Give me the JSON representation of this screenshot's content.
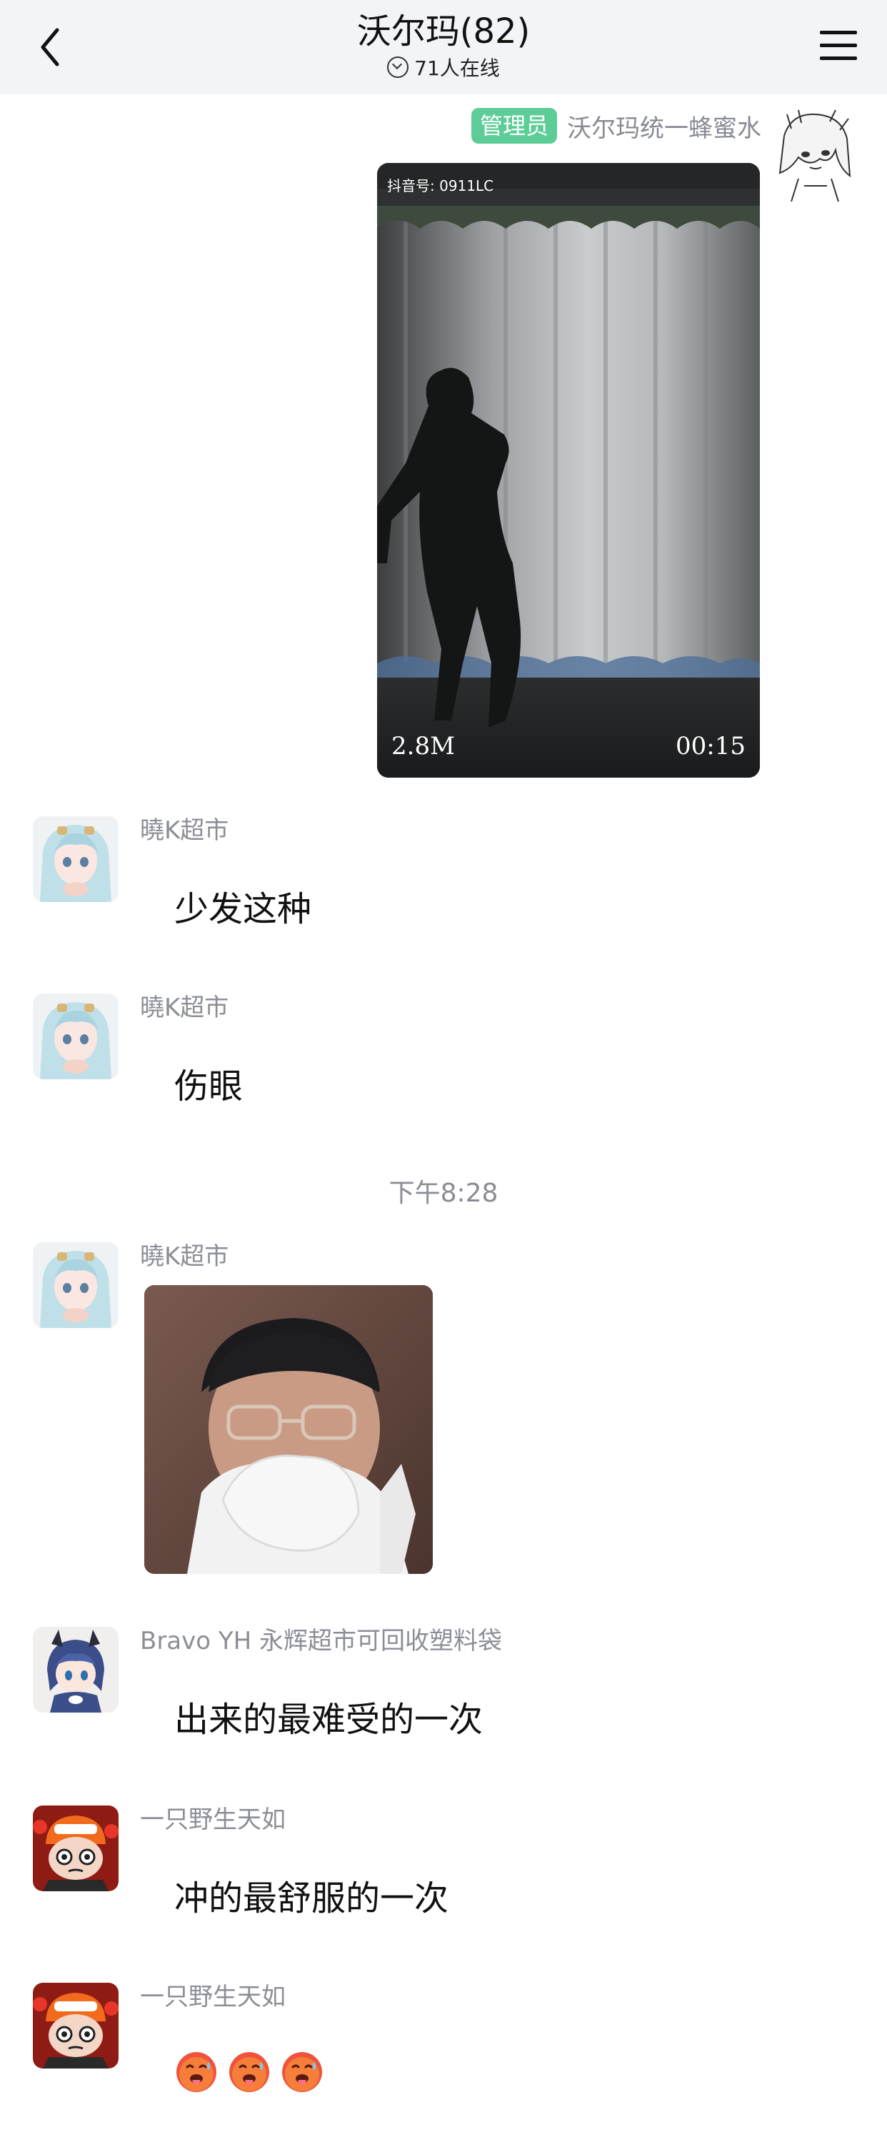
{
  "header": {
    "title": "沃尔玛(82)",
    "online": "71人在线"
  },
  "self_message": {
    "badge": "管理员",
    "name": "沃尔玛统一蜂蜜水",
    "video": {
      "douyin_id": "抖音号: 0911LC",
      "size": "2.8M",
      "duration": "00:15"
    }
  },
  "messages": [
    {
      "sender": "曉K超市",
      "text": "少发这种"
    },
    {
      "sender": "曉K超市",
      "text": "伤眼"
    },
    {
      "sender": "曉K超市",
      "sticker": "crying-man-sticker"
    },
    {
      "sender": "Bravo YH 永辉超市可回收塑料袋",
      "text": "出来的最难受的一次"
    },
    {
      "sender": "一只野生天如",
      "text": "冲的最舒服的一次"
    },
    {
      "sender": "一只野生天如",
      "emojis": [
        "hot-face",
        "hot-face",
        "hot-face"
      ]
    }
  ],
  "time_divider": "下午8:28",
  "colors": {
    "topbar": "#f3f4f8",
    "admin_badge": "#5ccd96",
    "sender_gray": "#8c8e97"
  }
}
